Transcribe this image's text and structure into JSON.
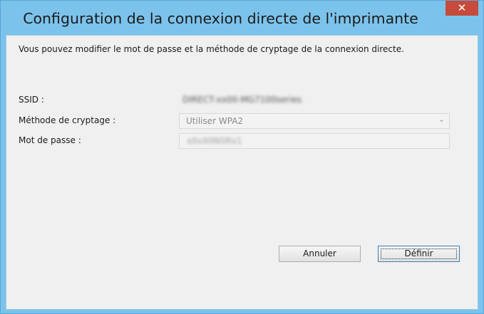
{
  "window": {
    "title": "Configuration de la connexion directe de l'imprimante",
    "close_label": "✕"
  },
  "content": {
    "description": "Vous pouvez modifier le mot de passe et la méthode de cryptage de la connexion directe.",
    "ssid_label": "SSID :",
    "ssid_value": "DIRECT-xx00-MG7100series",
    "encryption_label": "Méthode de cryptage :",
    "encryption_value": "Utiliser WPA2",
    "encryption_chevron": "⌄",
    "password_label": "Mot de passe :",
    "password_value": "x0vX0N5Rx1"
  },
  "buttons": {
    "cancel_label": "Annuler",
    "ok_label": "Définir"
  },
  "colors": {
    "title_bar": "#7cc3ec",
    "close_button": "#c74b3c",
    "client_bg": "#f0f0f0"
  },
  "icons": {
    "close": "close-icon",
    "dropdown": "chevron-down-icon"
  }
}
